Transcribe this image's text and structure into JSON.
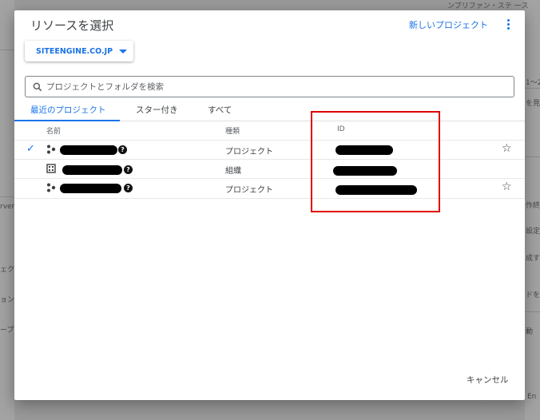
{
  "dialog": {
    "title": "リソースを選択",
    "new_project_label": "新しいプロジェクト",
    "org_select_value": "SITEENGINE.CO.JP",
    "search_placeholder": "プロジェクトとフォルダを検索",
    "tabs": [
      {
        "label": "最近のプロジェクト",
        "active": true
      },
      {
        "label": "スター付き",
        "active": false
      },
      {
        "label": "すべて",
        "active": false
      }
    ],
    "columns": {
      "name": "名前",
      "type": "種類",
      "id": "ID"
    },
    "rows": [
      {
        "type": "プロジェクト",
        "icon": "project-icon",
        "selected": true,
        "starred_icon": "star-outline-icon"
      },
      {
        "type": "組織",
        "icon": "organization-icon",
        "selected": false
      },
      {
        "type": "プロジェクト",
        "icon": "project-icon",
        "selected": false,
        "starred_icon": "star-outline-icon"
      }
    ],
    "help_glyph": "?",
    "check_glyph": "✓",
    "star_glyph": "☆",
    "cancel_label": "キャンセル"
  },
  "background": {
    "fragments": [
      "ンプリファン・ステ 一ス",
      "1〜2",
      "を見",
      "rver",
      "ェク",
      "ョン",
      "ープ",
      "作終",
      "設定す",
      "成す",
      "ドを",
      "動",
      "あります。",
      "En"
    ]
  },
  "colors": {
    "accent": "#1a73e8",
    "annotation": "#e00000"
  }
}
